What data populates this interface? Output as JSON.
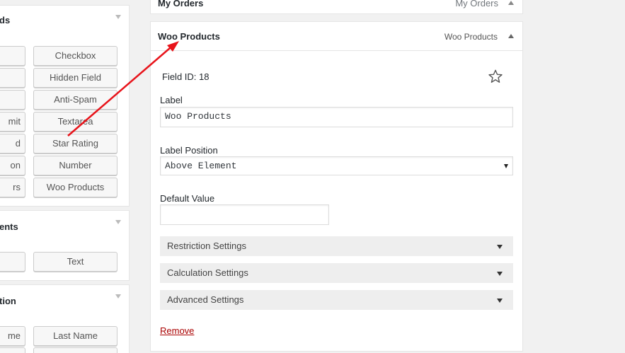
{
  "left_panels": [
    {
      "title": "ds",
      "buttons_left": [
        "",
        "",
        "",
        "mit",
        "d",
        "on",
        "rs"
      ],
      "buttons_right": [
        "Checkbox",
        "Hidden Field",
        "Anti-Spam",
        "Textarea",
        "Star Rating",
        "Number",
        "Woo Products"
      ]
    },
    {
      "title": "ents",
      "buttons_left": [
        ""
      ],
      "buttons_right": [
        "Text"
      ]
    },
    {
      "title": "tion",
      "buttons_left": [
        "me",
        ""
      ],
      "buttons_right": [
        "Last Name",
        ""
      ]
    }
  ],
  "prev_field": {
    "title": "My Orders",
    "type": "My Orders"
  },
  "field": {
    "title": "Woo Products",
    "type": "Woo Products",
    "id_label": "Field ID:",
    "id_value": "18",
    "label_label": "Label",
    "label_value": "Woo Products",
    "position_label": "Label Position",
    "position_value": "Above Element",
    "default_label": "Default Value",
    "default_value": "",
    "sections": [
      "Restriction Settings",
      "Calculation Settings",
      "Advanced Settings"
    ],
    "remove": "Remove"
  },
  "colors": {
    "annotation": "#e8141b",
    "remove_link": "#aa0000"
  },
  "icons": {
    "favorite": "star-outline-icon",
    "collapse": "caret-up-icon",
    "expand": "caret-down-icon"
  }
}
